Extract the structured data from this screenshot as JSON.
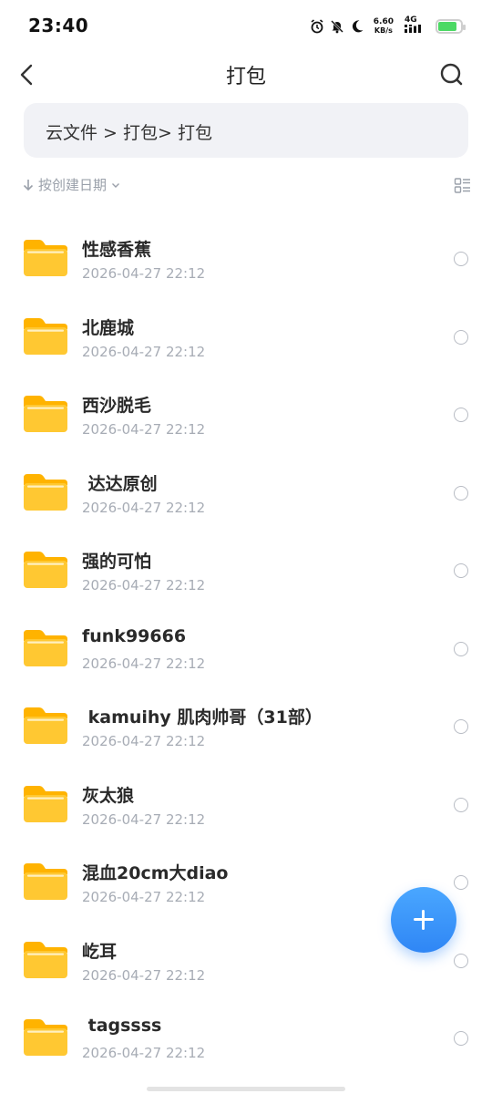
{
  "status_bar": {
    "time": "23:40",
    "net_speed_value": "6.60",
    "net_speed_unit": "KB/s",
    "signal_label": "4G",
    "battery_level": 0.85,
    "battery_color": "#4cd964",
    "icons": [
      "alarm-icon",
      "bell-off-icon",
      "moon-icon",
      "signal-icon",
      "battery-icon"
    ]
  },
  "header": {
    "title": "打包",
    "back_icon": "chevron-left-icon",
    "search_icon": "search-icon"
  },
  "breadcrumb": {
    "text": "云文件 > 打包> 打包"
  },
  "sort": {
    "label": "按创建日期",
    "direction_icon": "arrow-down-icon",
    "dropdown_icon": "chevron-down-icon",
    "view_toggle_icon": "list-view-icon"
  },
  "files": [
    {
      "name": "性感香蕉",
      "date": "2026-04-27 22:12"
    },
    {
      "name": "北鹿城",
      "date": "2026-04-27 22:12"
    },
    {
      "name": "西沙脱毛",
      "date": "2026-04-27 22:12"
    },
    {
      "name": " 达达原创",
      "date": "2026-04-27 22:12"
    },
    {
      "name": "强的可怕",
      "date": "2026-04-27 22:12"
    },
    {
      "name": "funk99666",
      "date": "2026-04-27 22:12"
    },
    {
      "name": " kamuihy 肌肉帅哥（31部）",
      "date": "2026-04-27 22:12"
    },
    {
      "name": "灰太狼",
      "date": "2026-04-27 22:12"
    },
    {
      "name": "混血20cm大diao",
      "date": "2026-04-27 22:12"
    },
    {
      "name": "屹耳",
      "date": "2026-04-27 22:12"
    },
    {
      "name": " tagssss",
      "date": "2026-04-27 22:12"
    }
  ],
  "fab": {
    "icon": "plus-icon",
    "color": "#2f86f5"
  },
  "colors": {
    "folder": "#ffc832",
    "folder_tab": "#ffb300",
    "accent": "#2f86f5"
  }
}
